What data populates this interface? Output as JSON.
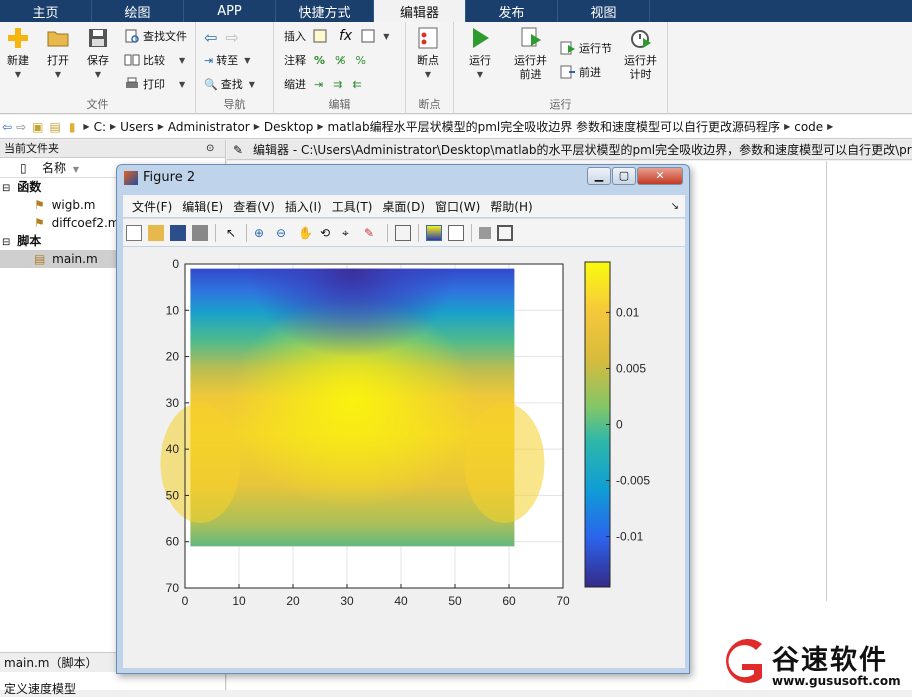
{
  "tabs": [
    "主页",
    "绘图",
    "APP",
    "快捷方式",
    "编辑器",
    "发布",
    "视图"
  ],
  "ribbon": {
    "file_group": {
      "title": "文件",
      "new": "新建",
      "open": "打开",
      "save": "保存",
      "find_files": "查找文件",
      "compare": "比较",
      "print": "打印"
    },
    "nav_group": {
      "title": "导航",
      "goto": "转至",
      "find": "查找"
    },
    "edit_group": {
      "title": "编辑",
      "insert": "插入",
      "comment": "注释",
      "indent": "缩进",
      "fx": "fx"
    },
    "bp_group": {
      "title": "断点",
      "breakpoints": "断点"
    },
    "run_group": {
      "title": "运行",
      "run": "运行",
      "run_advance": "运行并\n前进",
      "run_section": "运行节",
      "advance": "前进",
      "run_time": "运行并\n计时"
    }
  },
  "path": [
    "C:",
    "Users",
    "Administrator",
    "Desktop",
    "matlab编程水平层状模型的pml完全吸收边界 参数和速度模型可以自行更改源码程序",
    "code"
  ],
  "current_folder": {
    "title": "当前文件夹",
    "name_col": "名称",
    "functions_label": "函数",
    "scripts_label": "脚本",
    "files_functions": [
      "wigb.m",
      "diffcoef2.m"
    ],
    "files_scripts": [
      "main.m"
    ],
    "detail": "main.m（脚本）",
    "below_detail": "定义速度模型"
  },
  "editor": {
    "header": "编辑器 - C:\\Users\\Administrator\\Desktop\\matlab的水平层状模型的pml完全吸收边界，参数和速度模型可以自行更改\\pr"
  },
  "figure": {
    "title": "Figure 2",
    "menu": [
      "文件(F)",
      "编辑(E)",
      "查看(V)",
      "插入(I)",
      "工具(T)",
      "桌面(D)",
      "窗口(W)",
      "帮助(H)"
    ]
  },
  "chart_data": {
    "type": "heatmap",
    "title": "",
    "xlabel": "",
    "ylabel": "",
    "xlim": [
      0,
      70
    ],
    "ylim": [
      70,
      0
    ],
    "xticks": [
      0,
      10,
      20,
      30,
      40,
      50,
      60,
      70
    ],
    "yticks": [
      0,
      10,
      20,
      30,
      40,
      50,
      60,
      70
    ],
    "data_extent": {
      "x": [
        1,
        61
      ],
      "y": [
        1,
        61
      ]
    },
    "colormap": "parula",
    "colorbar": {
      "ticks": [
        0.01,
        0.005,
        0,
        -0.005,
        -0.01
      ],
      "tick_labels": [
        "0.01",
        "0.005",
        "0",
        "-0.005",
        "-0.01"
      ],
      "range": [
        -0.0145,
        0.0145
      ]
    },
    "grid": true
  },
  "watermark": {
    "name": "谷速软件",
    "url": "www.gususoft.com"
  }
}
